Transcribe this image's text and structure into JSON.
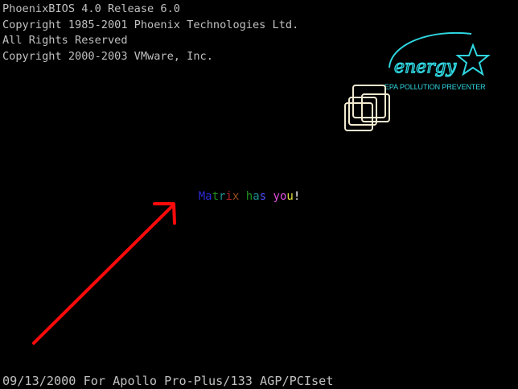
{
  "bios": {
    "header_lines": [
      "PhoenixBIOS 4.0 Release 6.0",
      "Copyright 1985-2001 Phoenix Technologies Ltd.",
      "All Rights Reserved",
      "Copyright 2000-2003 VMware, Inc."
    ],
    "energy_logo": {
      "icon": "energy-star-logo",
      "wordmark": "energy",
      "caption": "EPA POLLUTION PREVENTER",
      "color": "#2fd6e0"
    },
    "vmware_logo": {
      "icon": "vmware-logo",
      "color": "#f2ead0"
    },
    "message": {
      "segments": [
        {
          "text": "M",
          "color": "#2b2bd8"
        },
        {
          "text": "a",
          "color": "#2b2bd8"
        },
        {
          "text": "t",
          "color": "#1f8f1f"
        },
        {
          "text": "r",
          "color": "#1f8f8f"
        },
        {
          "text": "i",
          "color": "#b02020"
        },
        {
          "text": "x",
          "color": "#9a4f1a"
        },
        {
          "text": " ",
          "color": "#000000"
        },
        {
          "text": "h",
          "color": "#1f8f1f"
        },
        {
          "text": "a",
          "color": "#1f8f8f"
        },
        {
          "text": "s",
          "color": "#4d4dff"
        },
        {
          "text": " ",
          "color": "#000000"
        },
        {
          "text": "y",
          "color": "#e050e0"
        },
        {
          "text": "o",
          "color": "#e050e0"
        },
        {
          "text": "u",
          "color": "#e0e040"
        },
        {
          "text": "!",
          "color": "#ffffff"
        }
      ]
    },
    "annotation": {
      "icon": "red-arrow-icon",
      "color": "#ff0a0a"
    },
    "footer": "09/13/2000 For Apollo Pro-Plus/133 AGP/PCIset"
  }
}
